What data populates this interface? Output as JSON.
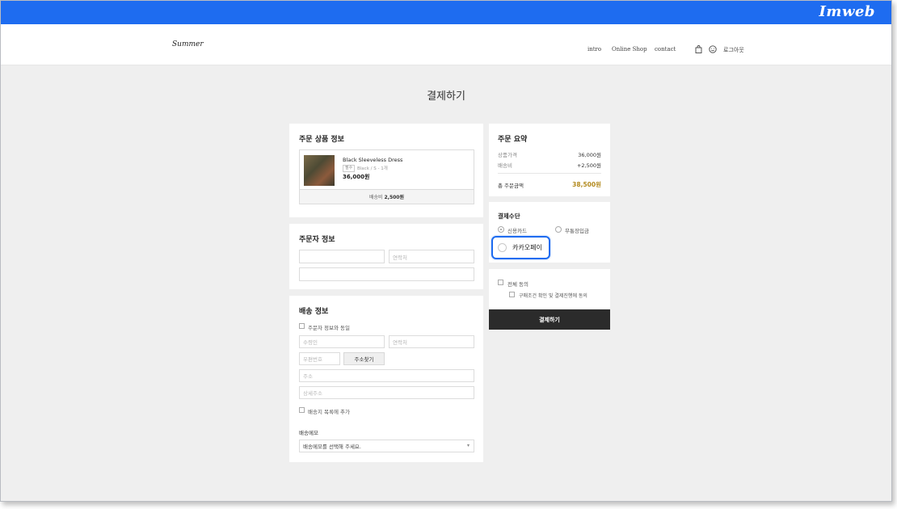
{
  "brand": "Imweb",
  "header": {
    "logo": "Summer",
    "nav": [
      "intro",
      "Online Shop",
      "contact"
    ],
    "logout": "로그아웃"
  },
  "page": {
    "title": "결제하기"
  },
  "order_products": {
    "title": "주문 상품 정보",
    "product": {
      "name": "Black Sleeveless Dress",
      "tag": "필수",
      "option": "Black / S - 1개",
      "price": "36,000원"
    },
    "shipping_label": "배송비",
    "shipping_value": "2,500원"
  },
  "orderer": {
    "title": "주문자 정보",
    "contact_placeholder": "연락처"
  },
  "delivery": {
    "title": "배송 정보",
    "same_as_orderer": "주문자 정보와 동일",
    "recipient_placeholder": "수령인",
    "contact_placeholder": "연락처",
    "zipcode_placeholder": "우편번호",
    "address_search_button": "주소찾기",
    "address_placeholder": "주소",
    "address_detail_placeholder": "상세주소",
    "add_to_list": "배송지 목록에 추가",
    "memo_label": "배송메모",
    "memo_select": "배송메모를 선택해 주세요."
  },
  "summary": {
    "title": "주문 요약",
    "rows": [
      {
        "label": "상품가격",
        "value": "36,000원"
      },
      {
        "label": "배송비",
        "value": "+2,500원"
      }
    ],
    "total_label": "총 주문금액",
    "total_value": "38,500원"
  },
  "payment": {
    "title": "결제수단",
    "methods": [
      "신용카드",
      "무통장입금",
      "카카오페이"
    ],
    "selected": "신용카드"
  },
  "agreement": {
    "all": "전체 동의",
    "terms": "구매조건 확인 및 결제진행에 동의"
  },
  "pay_button": "결제하기",
  "colors": {
    "topbar": "#1e6cf0",
    "highlight": "#1e6cf0",
    "total_accent": "#b38a1e",
    "pay_button_bg": "#2b2b2b"
  },
  "icons": [
    "bag-icon",
    "smile-icon",
    "product-thumbnail",
    "chevron-down-icon"
  ]
}
